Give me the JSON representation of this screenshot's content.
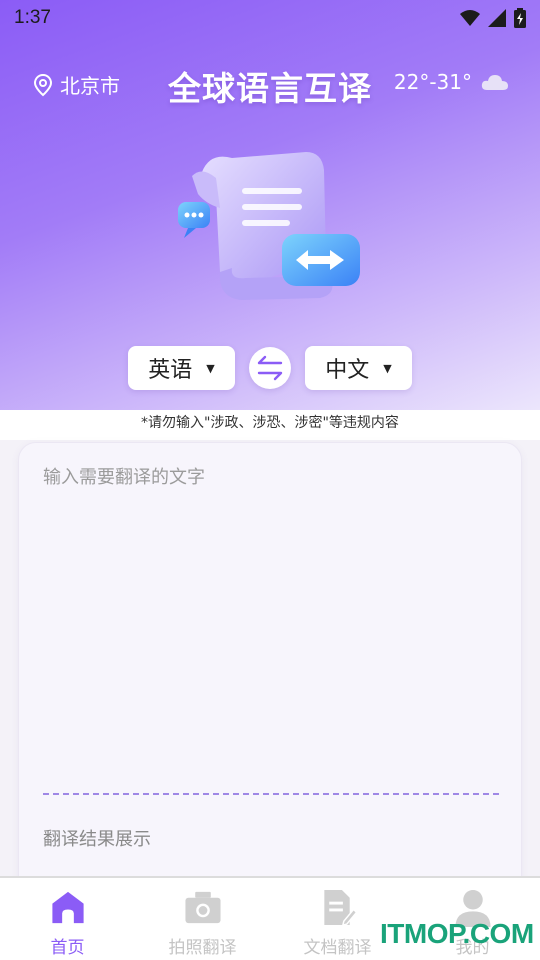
{
  "status_bar": {
    "time": "1:37"
  },
  "header": {
    "location": "北京市",
    "title": "全球语言互译",
    "weather": "22°-31°"
  },
  "languages": {
    "source": "英语",
    "target": "中文"
  },
  "notice": "*请勿输入\"涉政、涉恐、涉密\"等违规内容",
  "input": {
    "placeholder": "输入需要翻译的文字"
  },
  "result": {
    "label": "翻译结果展示"
  },
  "tabs": [
    {
      "label": "首页",
      "active": true
    },
    {
      "label": "拍照翻译",
      "active": false
    },
    {
      "label": "文档翻译",
      "active": false
    },
    {
      "label": "我的",
      "active": false
    }
  ],
  "watermark": "ITMOP.COM",
  "colors": {
    "accent": "#8b5cf6",
    "watermark": "#1aa37a"
  }
}
